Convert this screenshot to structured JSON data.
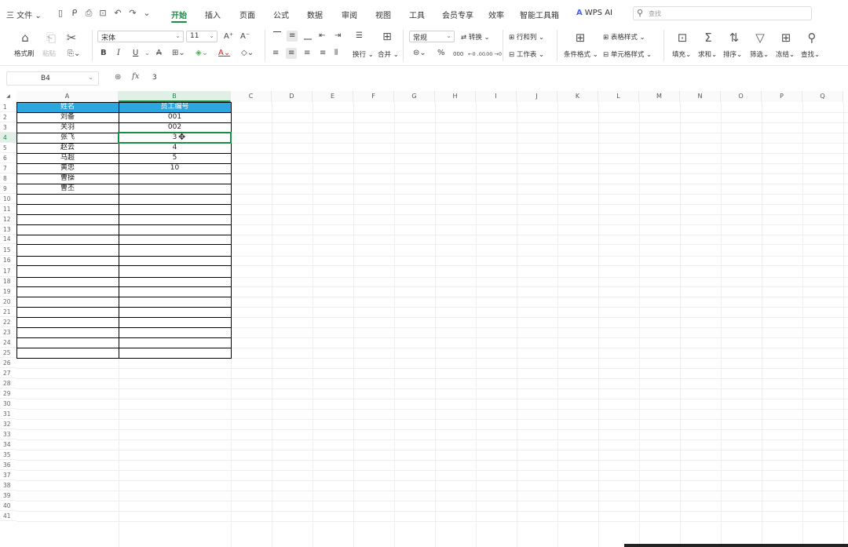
{
  "menubar": {
    "file_label": "三 文件 ⌄",
    "quick_access": [
      {
        "name": "save-icon",
        "glyph": "🗎"
      },
      {
        "name": "save-as-icon",
        "glyph": "⎘"
      },
      {
        "name": "print-icon",
        "glyph": "⎙"
      },
      {
        "name": "preview-icon",
        "glyph": "🔍"
      },
      {
        "name": "undo-icon",
        "glyph": "↶"
      },
      {
        "name": "redo-icon",
        "glyph": "↷"
      },
      {
        "name": "more-icon",
        "glyph": "⌄"
      }
    ],
    "tabs": [
      "开始",
      "插入",
      "页面",
      "公式",
      "数据",
      "审阅",
      "视图",
      "工具",
      "会员专享",
      "效率",
      "智能工具箱"
    ],
    "active_tab": "开始",
    "wps_ai": "WPS AI",
    "search_placeholder": "查找"
  },
  "ribbon": {
    "format_painter": "格式刷",
    "paste": "粘贴",
    "font_name": "宋体",
    "font_size": "11",
    "bold": "B",
    "italic": "I",
    "underline": "U",
    "strike": "A",
    "number_format": "常规",
    "convert": "转换",
    "rows_cols": "行和列",
    "worksheet": "工作表",
    "wrap": "换行",
    "merge": "合并",
    "cond_format": "条件格式",
    "table_style": "表格样式",
    "cell_style": "单元格样式",
    "fill": "填充",
    "sum": "求和",
    "sort": "排序",
    "filter": "筛选",
    "freeze": "冻结",
    "find": "查找",
    "percent": "%",
    "thousands": "000",
    "dec_inc": "←0 .00",
    "dec_dec": ".00 →0"
  },
  "formula_bar": {
    "cell_ref": "B4",
    "fx": "fx",
    "value": "3"
  },
  "sheet": {
    "columns": [
      "A",
      "B",
      "C",
      "D",
      "E",
      "F",
      "G",
      "H",
      "I",
      "J",
      "K",
      "L",
      "M",
      "N",
      "O",
      "P",
      "Q"
    ],
    "selected_column": "B",
    "row_count": 41,
    "selected_row": 4,
    "table_headers": [
      "姓名",
      "员工编号"
    ],
    "rows": [
      [
        "刘备",
        "001"
      ],
      [
        "关羽",
        "002"
      ],
      [
        "张飞",
        "3"
      ],
      [
        "赵云",
        "4"
      ],
      [
        "马超",
        "5"
      ],
      [
        "黄忠",
        "10"
      ],
      [
        "曹操",
        ""
      ],
      [
        "曹丕",
        ""
      ]
    ],
    "active_cell": "B4"
  },
  "colors": {
    "accent": "#1a8c45",
    "header_fill": "#2ca6de"
  }
}
